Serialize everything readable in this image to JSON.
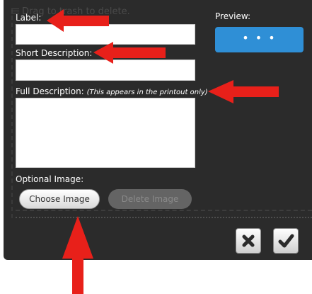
{
  "background_hint": "Drag to trash to delete.",
  "form": {
    "label": {
      "title": "Label:",
      "value": ""
    },
    "short_description": {
      "title": "Short Description:",
      "value": ""
    },
    "full_description": {
      "title": "Full Description:",
      "note": "(This appears in the printout only)",
      "value": ""
    },
    "optional_image": {
      "title": "Optional Image:",
      "choose_label": "Choose Image",
      "delete_label": "Delete Image"
    }
  },
  "preview": {
    "title": "Preview:",
    "button_label": "• • •"
  },
  "actions": {
    "cancel_icon": "close-icon",
    "confirm_icon": "checkmark-icon"
  },
  "colors": {
    "dialog_bg": "#2b2b2b",
    "preview_blue": "#2f8fd6",
    "annotation_red": "#e8201a"
  }
}
